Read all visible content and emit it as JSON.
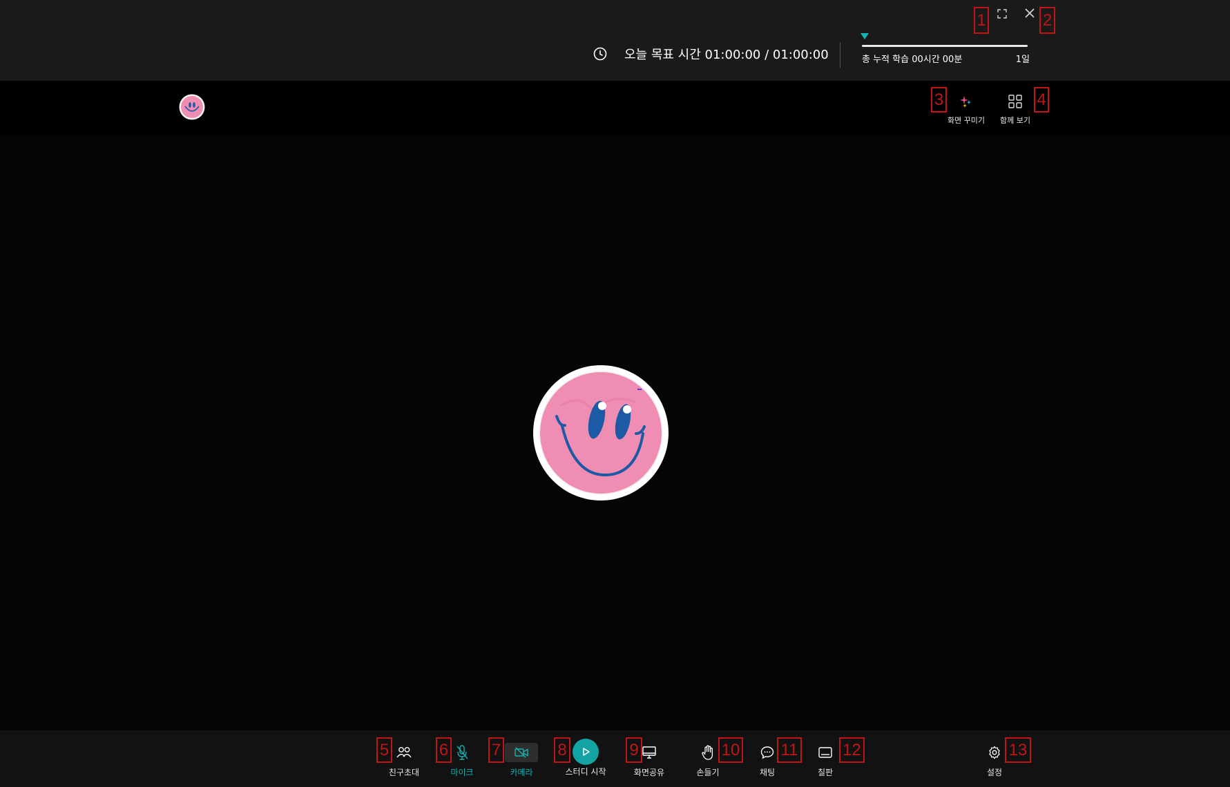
{
  "window": {
    "expand_icon": "expand-icon",
    "close_icon": "close-icon"
  },
  "goal": {
    "icon": "clock-icon",
    "text": "오늘 목표 시간 01:00:00 / 01:00:00"
  },
  "progress": {
    "fraction": 1.0,
    "cumulative_label": "총 누적 학습 00시간 00분",
    "days_label": "1일"
  },
  "toolbar": {
    "decorate_label": "화면 꾸미기",
    "decorate_icon": "sparkle-icon",
    "gallery_label": "함께 보기",
    "gallery_icon": "grid-icon"
  },
  "controls": {
    "invite_label": "친구초대",
    "mic_label": "마이크",
    "camera_label": "카메라",
    "study_start_label": "스터디 시작",
    "screen_share_label": "화면공유",
    "raise_hand_label": "손들기",
    "chat_label": "채팅",
    "whiteboard_label": "칠판",
    "settings_label": "설정"
  },
  "annotations": [
    "1",
    "2",
    "3",
    "4",
    "5",
    "6",
    "7",
    "8",
    "9",
    "10",
    "11",
    "12",
    "13"
  ],
  "colors": {
    "accent": "#13b4b4",
    "annotation": "#c01616",
    "avatar_pink": "#f08db2",
    "avatar_blue": "#1d5aa6"
  }
}
